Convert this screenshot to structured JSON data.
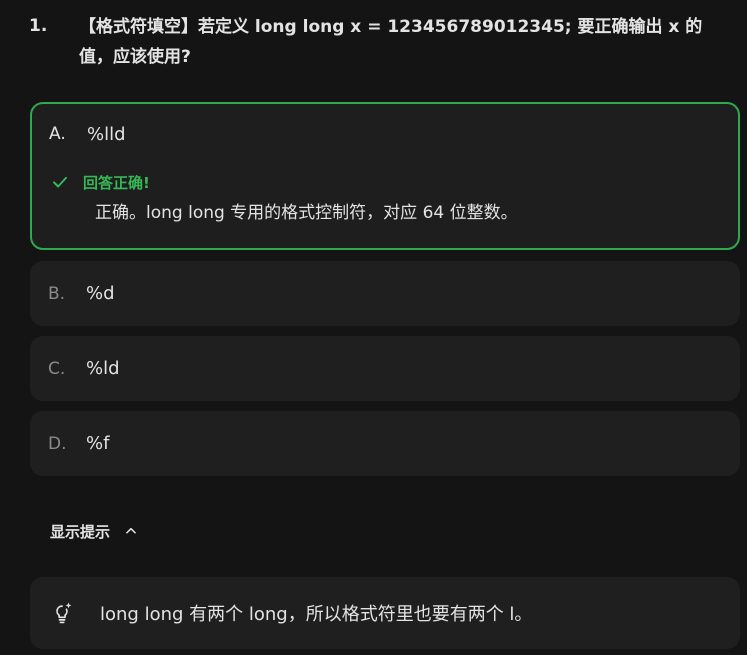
{
  "question": {
    "number": "1.",
    "text": "【格式符填空】若定义 long long x = 123456789012345; 要正确输出 x 的值，应该使用?"
  },
  "options": [
    {
      "letter": "A.",
      "text": "%lld",
      "status": "correct"
    },
    {
      "letter": "B.",
      "text": "%d"
    },
    {
      "letter": "C.",
      "text": "%ld"
    },
    {
      "letter": "D.",
      "text": "%f"
    }
  ],
  "feedback": {
    "icon": "check-icon",
    "title": "回答正确!",
    "body": "正确。long long 专用的格式控制符，对应 64 位整数。"
  },
  "hint": {
    "toggle_label": "显示提示",
    "toggle_icon": "chevron-up-icon",
    "icon": "lightbulb-sparkle-icon",
    "text": "long long 有两个 long，所以格式符里也要有两个 l。"
  },
  "colors": {
    "background": "#141414",
    "card": "#1f1f1f",
    "correct_accent": "#2fa84f",
    "text": "#e3e3e3",
    "muted": "#8a8a8a"
  }
}
